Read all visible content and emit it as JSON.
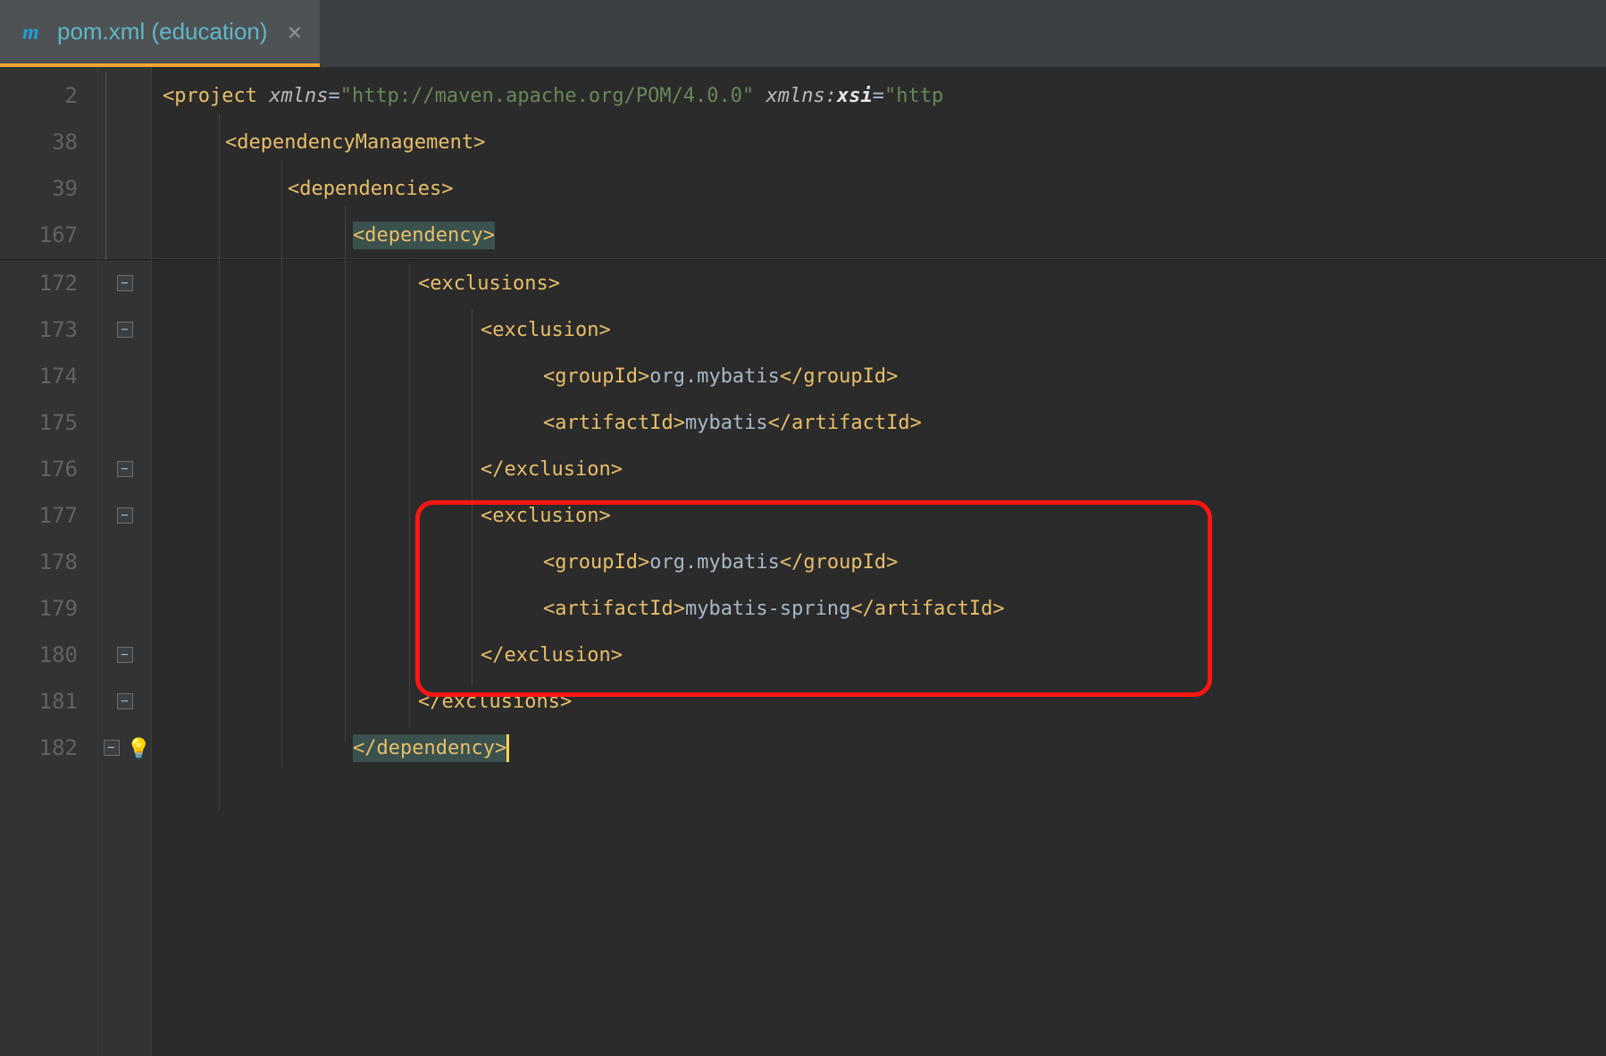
{
  "tab": {
    "label": "pom.xml (education)",
    "icon_letter": "m"
  },
  "gutter_lines": [
    "2",
    "38",
    "39",
    "167",
    "172",
    "173",
    "174",
    "175",
    "176",
    "177",
    "178",
    "179",
    "180",
    "181",
    "182"
  ],
  "code": {
    "l2": {
      "tag": "project",
      "attr1": "xmlns",
      "val1": "\"http://maven.apache.org/POM/4.0.0\"",
      "attr2_ns": "xmlns",
      "attr2_nm": "xsi",
      "val2": "\"http"
    },
    "l38": {
      "tag": "dependencyManagement"
    },
    "l39": {
      "tag": "dependencies"
    },
    "l167": {
      "tag": "dependency"
    },
    "l172": {
      "tag": "exclusions"
    },
    "l173": {
      "tag": "exclusion"
    },
    "l174": {
      "open": "groupId",
      "text": "org.mybatis",
      "close": "groupId"
    },
    "l175": {
      "open": "artifactId",
      "text": "mybatis",
      "close": "artifactId"
    },
    "l176": {
      "tag": "exclusion"
    },
    "l177": {
      "tag": "exclusion"
    },
    "l178": {
      "open": "groupId",
      "text": "org.mybatis",
      "close": "groupId"
    },
    "l179": {
      "open": "artifactId",
      "text": "mybatis-spring",
      "close": "artifactId"
    },
    "l180": {
      "tag": "exclusion"
    },
    "l181": {
      "tag": "exclusions"
    },
    "l182": {
      "tag": "dependency"
    }
  }
}
